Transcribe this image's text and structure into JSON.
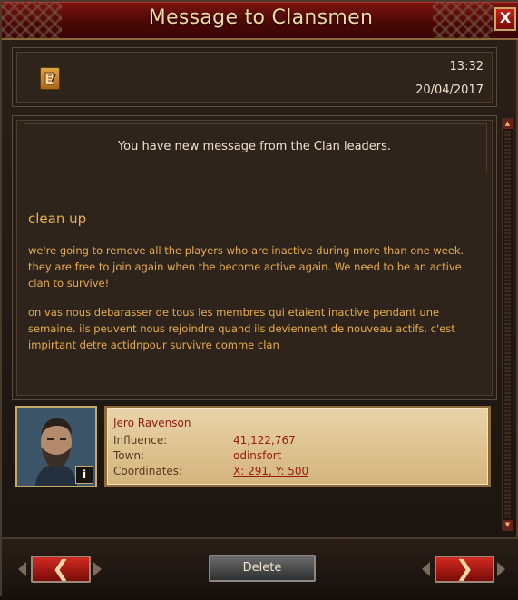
{
  "window": {
    "title": "Message to Clansmen",
    "close_label": "X"
  },
  "header": {
    "time": "13:32",
    "date": "20/04/2017"
  },
  "message": {
    "notice": "You have new message from the Clan leaders.",
    "subject": "clean up",
    "paragraphs": [
      "we're going to remove all the players who are inactive during more than one week. they are free to join again when the become active again. We need to be an active clan to survive!",
      "on vas nous debarasser de tous les membres qui etaient inactive pendant une semaine. ils peuvent nous rejoindre quand ils deviennent de nouveau actifs. c'est impirtant detre actidnpour survivre comme clan"
    ]
  },
  "sender": {
    "name": "Jero Ravenson",
    "influence_label": "Influence:",
    "influence_value": "41,122,767",
    "town_label": "Town:",
    "town_value": "odinsfort",
    "coords_label": "Coordinates:",
    "coords_value": "X: 291, Y: 500",
    "info_label": "i"
  },
  "footer": {
    "prev_label": "❮",
    "delete_label": "Delete",
    "next_label": "❯"
  },
  "colors": {
    "accent": "#c4221b",
    "text_gold": "#e7ad47",
    "card_bg": "#e9d3a8"
  }
}
